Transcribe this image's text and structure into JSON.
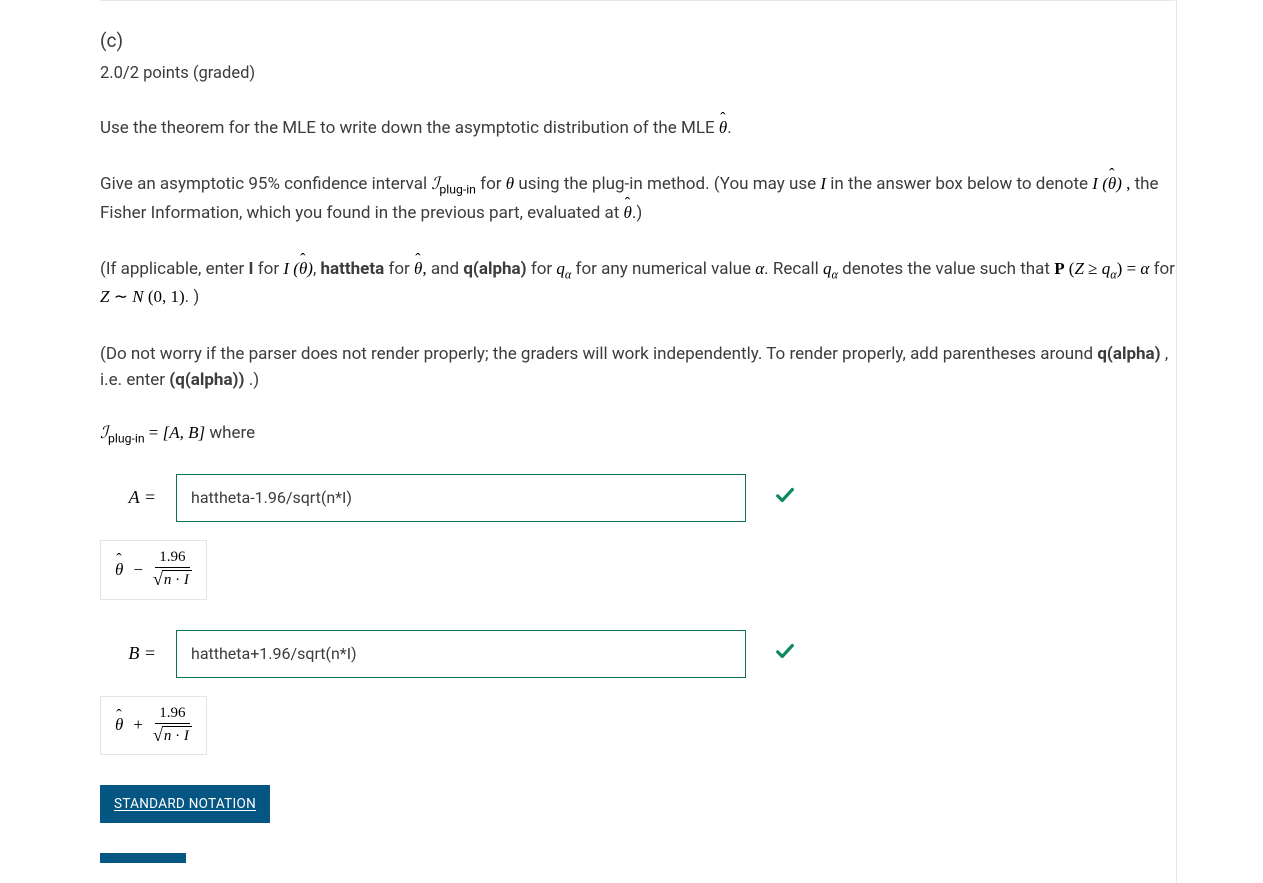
{
  "part_label": "(c)",
  "points_line": "2.0/2 points (graded)",
  "para1_a": "Use the theorem for the MLE to write down the asymptotic distribution of the MLE ",
  "para1_b": ".",
  "para2_a": "Give an asymptotic 95% confidence interval ",
  "para2_b": " for ",
  "para2_c": " using the plug-in method. (You may use ",
  "para2_d": " in the answer box below to denote ",
  "para2_e": " the Fisher Information, which you found in the previous part, evaluated at ",
  "para2_f": ".)",
  "para3_a": "(If applicable, enter ",
  "para3_I": "I",
  "para3_b": " for ",
  "para3_c": ", ",
  "para3_hattheta": "hattheta",
  "para3_d": " for ",
  "para3_e": " and ",
  "para3_qalpha": "q(alpha)",
  "para3_f": " for ",
  "para3_g": " for any numerical value ",
  "para3_h": ". Recall ",
  "para3_i": " denotes the value such that ",
  "para3_j": " for ",
  "para3_k": ". )",
  "para4_a": "(Do not worry if the parser does not render properly; the graders will work independently. To render properly, add parentheses around ",
  "para4_qalpha": "q(alpha)",
  "para4_b": ", i.e. enter ",
  "para4_paren": "(q(alpha))",
  "para4_c": ".)",
  "interval_eq": " = ",
  "interval_AB": "[A, B]",
  "interval_where": " where",
  "answers": {
    "A": {
      "label": "A  =",
      "value": "hattheta-1.96/sqrt(n*I)"
    },
    "B": {
      "label": "B  =",
      "value": "hattheta+1.96/sqrt(n*I)"
    }
  },
  "formula": {
    "num": "1.96",
    "radicand_n": "n",
    "radicand_dot": " · ",
    "radicand_I": "I"
  },
  "std_notation": "STANDARD NOTATION",
  "theta": "θ",
  "I": "I",
  "alpha": "α",
  "q": "q",
  "Z": "Z",
  "P": "P",
  "N": "N",
  "geq": "≥",
  "sim": "∼",
  "zero_one": "(0, 1)",
  "iplugin_sub": "plug-in",
  "comma_sp": ",",
  "surd": "√"
}
